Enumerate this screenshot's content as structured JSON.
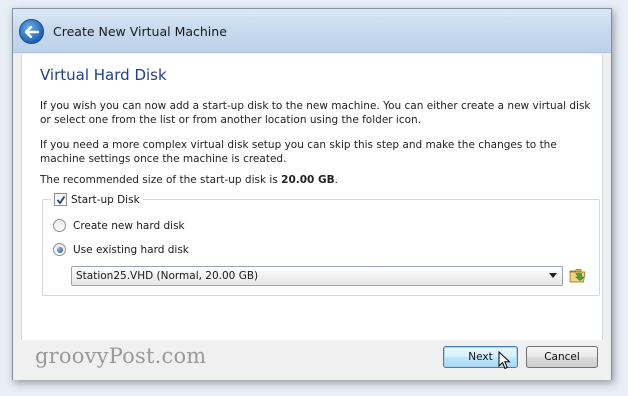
{
  "window": {
    "title": "Create New Virtual Machine"
  },
  "page": {
    "heading": "Virtual Hard Disk",
    "paragraph1": "If you wish you can now add a start-up disk to the new machine. You can either create a new virtual disk or select one from the list or from another location using the folder icon.",
    "paragraph2": "If you need a more complex virtual disk setup you can skip this step and make the changes to the machine settings once the machine is created.",
    "recommended_prefix": "The recommended size of the start-up disk is ",
    "recommended_size": "20.00 GB",
    "recommended_suffix": "."
  },
  "startup_disk": {
    "checkbox_label": "Start-up Disk",
    "checked": true,
    "option_create": "Create new hard disk",
    "option_existing": "Use existing hard disk",
    "selected_option": "existing",
    "disk_selected": "Station25.VHD (Normal, 20.00 GB)"
  },
  "icons": {
    "back": "back-arrow-icon",
    "folder": "folder-icon",
    "dropdown": "chevron-down-icon",
    "cursor": "mouse-cursor-icon"
  },
  "footer": {
    "watermark": "groovyPost.com",
    "next_label": "Next",
    "cancel_label": "Cancel"
  },
  "colors": {
    "heading": "#1e3f8a",
    "titlebar": "#c5d8ee",
    "next_button": "#bee6fd"
  }
}
